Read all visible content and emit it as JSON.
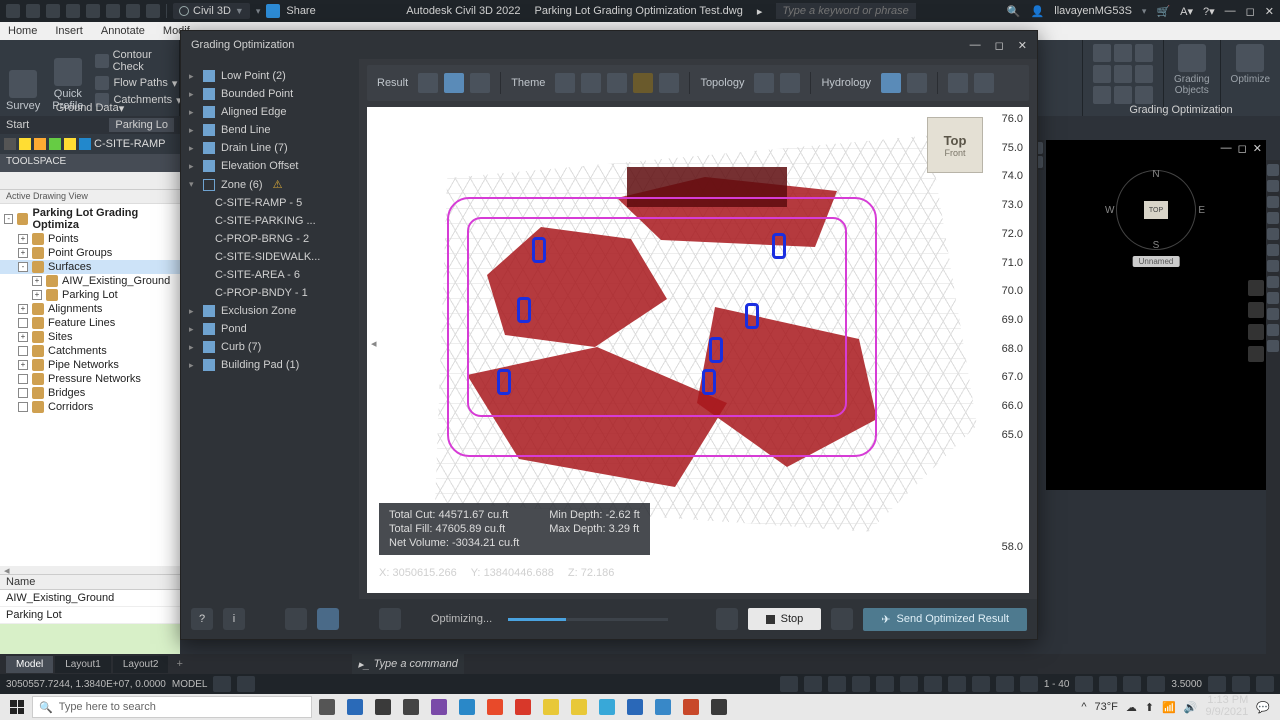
{
  "titlebar": {
    "brand": "Civil 3D",
    "share": "Share",
    "app_full": "Autodesk Civil 3D 2022",
    "doc": "Parking Lot Grading Optimization Test.dwg",
    "keyword_placeholder": "Type a keyword or phrase",
    "user": "llavayenMG53S"
  },
  "menubar": [
    "Home",
    "Insert",
    "Annotate",
    "Modif"
  ],
  "ribbon": {
    "left": {
      "survey": "Survey",
      "quick_profile": "Quick\nProfile",
      "contour_check": "Contour Check",
      "flow_paths": "Flow Paths",
      "catchments": "Catchments",
      "group_label": "Ground Data"
    },
    "right": {
      "grading_objects": "Grading\nObjects",
      "optimize": "Optimize",
      "group_label": "Grading Optimization"
    }
  },
  "workspace": {
    "start": "Start",
    "doc_tab": "Parking Lo",
    "layer": "C-SITE-RAMP",
    "toolspace": "TOOLSPACE",
    "active_view": "Active Drawing View",
    "tree": [
      {
        "label": "Parking Lot Grading Optimiza",
        "depth": 0,
        "exp": "-",
        "bold": true
      },
      {
        "label": "Points",
        "depth": 1,
        "exp": "+"
      },
      {
        "label": "Point Groups",
        "depth": 1,
        "exp": "+"
      },
      {
        "label": "Surfaces",
        "depth": 1,
        "exp": "-",
        "sel": true
      },
      {
        "label": "AIW_Existing_Ground",
        "depth": 2,
        "exp": "+"
      },
      {
        "label": "Parking Lot",
        "depth": 2,
        "exp": "+"
      },
      {
        "label": "Alignments",
        "depth": 1,
        "exp": "+"
      },
      {
        "label": "Feature Lines",
        "depth": 1,
        "exp": ""
      },
      {
        "label": "Sites",
        "depth": 1,
        "exp": "+"
      },
      {
        "label": "Catchments",
        "depth": 1,
        "exp": ""
      },
      {
        "label": "Pipe Networks",
        "depth": 1,
        "exp": "+"
      },
      {
        "label": "Pressure Networks",
        "depth": 1,
        "exp": ""
      },
      {
        "label": "Bridges",
        "depth": 1,
        "exp": ""
      },
      {
        "label": "Corridors",
        "depth": 1,
        "exp": ""
      }
    ],
    "name_hdr": "Name",
    "name_list": [
      "AIW_Existing_Ground",
      "Parking Lot"
    ]
  },
  "dialog": {
    "title": "Grading Optimization",
    "tree": [
      {
        "label": "Low Point (2)",
        "type": "cat"
      },
      {
        "label": "Bounded Point",
        "type": "cat"
      },
      {
        "label": "Aligned Edge",
        "type": "cat"
      },
      {
        "label": "Bend Line",
        "type": "cat"
      },
      {
        "label": "Drain Line (7)",
        "type": "cat"
      },
      {
        "label": "Elevation Offset",
        "type": "cat"
      },
      {
        "label": "Zone (6)",
        "type": "cat-open"
      },
      {
        "label": "C-SITE-RAMP - 5",
        "type": "sub"
      },
      {
        "label": "C-SITE-PARKING ...",
        "type": "sub"
      },
      {
        "label": "C-PROP-BRNG - 2",
        "type": "sub"
      },
      {
        "label": "C-SITE-SIDEWALK...",
        "type": "sub"
      },
      {
        "label": "C-SITE-AREA - 6",
        "type": "sub"
      },
      {
        "label": "C-PROP-BNDY - 1",
        "type": "sub"
      },
      {
        "label": "Exclusion Zone",
        "type": "cat"
      },
      {
        "label": "Pond",
        "type": "cat"
      },
      {
        "label": "Curb (7)",
        "type": "cat"
      },
      {
        "label": "Building Pad (1)",
        "type": "cat"
      }
    ],
    "toolbar": {
      "result": "Result",
      "theme": "Theme",
      "topology": "Topology",
      "hydrology": "Hydrology"
    },
    "viewcube": {
      "top": "Top",
      "front": "Front"
    },
    "elev": [
      "76.0",
      "75.0",
      "74.0",
      "73.0",
      "72.0",
      "71.0",
      "70.0",
      "69.0",
      "68.0",
      "67.0",
      "66.0",
      "65.0",
      "",
      "",
      "",
      "",
      "",
      "58.0"
    ],
    "stats": {
      "total_cut_label": "Total Cut:",
      "total_cut": "44571.67 cu.ft",
      "total_fill_label": "Total Fill:",
      "total_fill": "47605.89 cu.ft",
      "net_vol_label": "Net Volume:",
      "net_vol": "-3034.21 cu.ft",
      "min_depth_label": "Min Depth:",
      "min_depth": "-2.62 ft",
      "max_depth_label": "Max Depth:",
      "max_depth": "3.29 ft"
    },
    "coords": {
      "x_label": "X:",
      "x": "3050615.266",
      "y_label": "Y:",
      "y": "13840446.688",
      "z_label": "Z:",
      "z": "72.186"
    },
    "footer": {
      "optimizing": "Optimizing...",
      "stop": "Stop",
      "send": "Send Optimized Result"
    }
  },
  "right_vp": {
    "unnamed": "Unnamed",
    "n": "N",
    "e": "E",
    "s": "S",
    "w": "W",
    "top": "TOP"
  },
  "doc_tabs": {
    "model": "Model",
    "layout1": "Layout1",
    "layout2": "Layout2"
  },
  "cmdline": "Type a command",
  "statusbar": {
    "coords": "3050557.7244, 1.3840E+07, 0.0000",
    "model": "MODEL",
    "scale": "1 - 40",
    "decimal": "3.5000"
  },
  "taskbar": {
    "search_placeholder": "Type here to search",
    "temp": "73°F",
    "time": "1:13 PM",
    "date": "9/9/2021"
  }
}
